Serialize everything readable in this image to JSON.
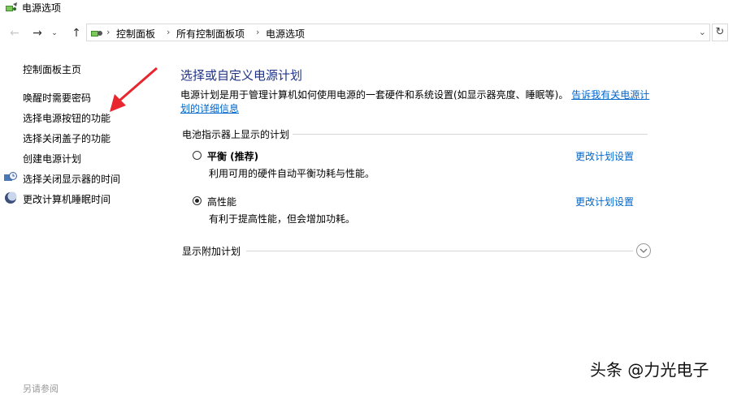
{
  "window": {
    "title": "电源选项"
  },
  "breadcrumb": [
    "控制面板",
    "所有控制面板项",
    "电源选项"
  ],
  "sidebar": {
    "home": "控制面板主页",
    "items": [
      {
        "label": "唤醒时需要密码",
        "icon": null
      },
      {
        "label": "选择电源按钮的功能",
        "icon": null
      },
      {
        "label": "选择关闭盖子的功能",
        "icon": null
      },
      {
        "label": "创建电源计划",
        "icon": null
      },
      {
        "label": "选择关闭显示器的时间",
        "icon": "monitor-clock-icon"
      },
      {
        "label": "更改计算机睡眠时间",
        "icon": "moon-icon"
      }
    ],
    "see_also": "另请参阅"
  },
  "main": {
    "title": "选择或自定义电源计划",
    "description": "电源计划是用于管理计算机如何使用电源的一套硬件和系统设置(如显示器亮度、睡眠等)。",
    "description_link": "告诉我有关电源计划的详细信息",
    "section_battery": "电池指示器上显示的计划",
    "plans": [
      {
        "name": "平衡 (推荐)",
        "description": "利用可用的硬件自动平衡功耗与性能。",
        "link": "更改计划设置",
        "selected": false
      },
      {
        "name": "高性能",
        "description": "有利于提高性能，但会增加功耗。",
        "link": "更改计划设置",
        "selected": true
      }
    ],
    "section_additional": "显示附加计划"
  },
  "watermark": "头条 @力光电子",
  "colors": {
    "title_blue": "#1e3287",
    "link_blue": "#0066cc",
    "annotation_red": "#e8262d"
  }
}
